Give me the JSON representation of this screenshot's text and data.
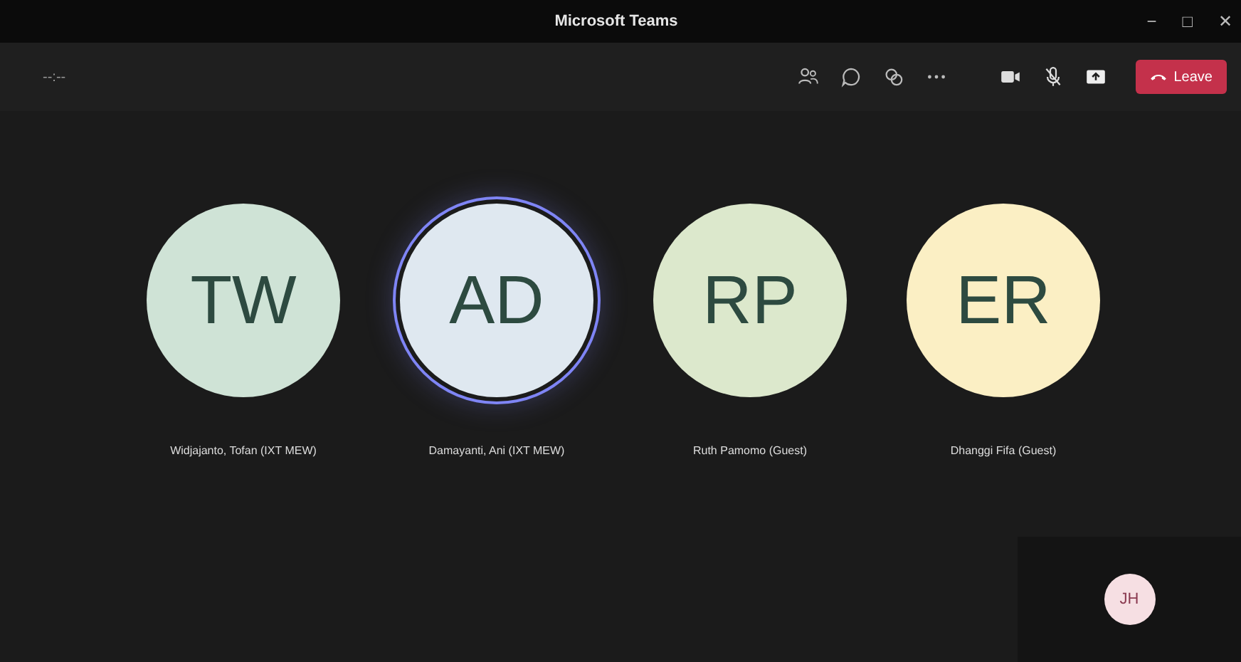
{
  "window": {
    "title": "Microsoft Teams",
    "controls": [
      "−",
      "□",
      "✕"
    ]
  },
  "toolbar": {
    "timer": "--:--",
    "leave_label": "Leave"
  },
  "participants": [
    {
      "initials": "TW",
      "name": "Widjajanto, Tofan (IXT MEW)",
      "color": "#cfe3d6",
      "speaking": false
    },
    {
      "initials": "AD",
      "name": "Damayanti, Ani (IXT MEW)",
      "color": "#dfe8f0",
      "speaking": true
    },
    {
      "initials": "RP",
      "name": "Ruth Pamomo (Guest)",
      "color": "#dce8cc",
      "speaking": false
    },
    {
      "initials": "ER",
      "name": "Dhanggi Fifa (Guest)",
      "color": "#fbefc4",
      "speaking": false
    }
  ],
  "self_view": {
    "initials": "JH",
    "color": "#f6dfe3"
  }
}
